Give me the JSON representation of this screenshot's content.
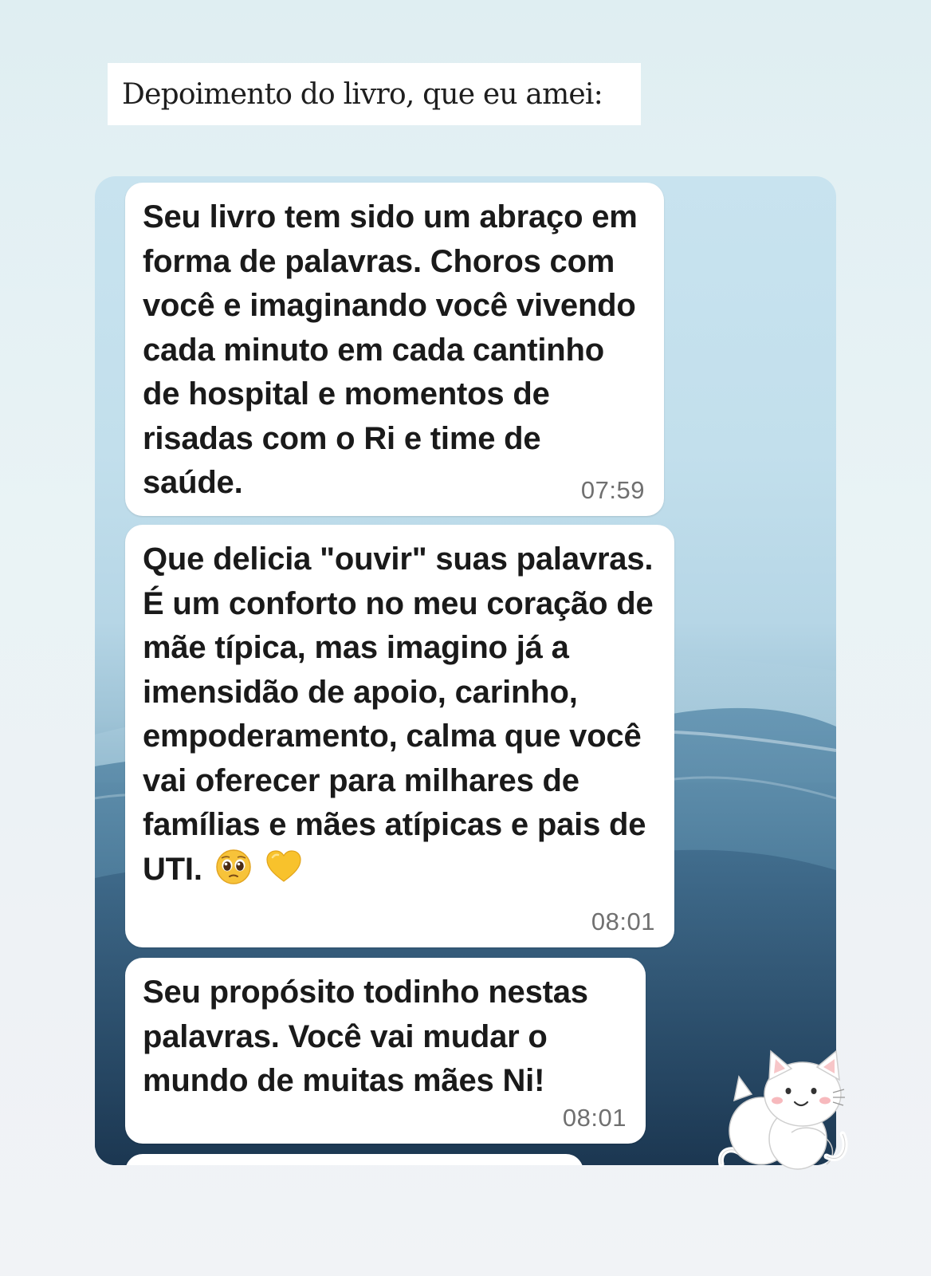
{
  "caption": {
    "text": "Depoimento do livro, que eu amei:"
  },
  "chat": {
    "messages": [
      {
        "text": "Seu livro tem sido um abraço em forma de palavras. Choros com você e imaginando você vivendo cada minuto em cada cantinho de hospital e momentos de risadas com o Ri e time de saúde.",
        "time": "07:59"
      },
      {
        "text": "Que delicia \"ouvir\" suas palavras. É um conforto no meu coração de mãe típica, mas imagino já a imensidão de apoio, carinho, empoderamento, calma que você vai oferecer para milhares de famílias e mães atípicas e pais de UTI.",
        "time": "08:01",
        "emojis": [
          "pleading-face-emoji",
          "yellow-heart-emoji"
        ]
      },
      {
        "text": "Seu propósito todinho nestas palavras. Você vai mudar o mundo de muitas mães Ni!",
        "time": "08:01"
      }
    ]
  },
  "sticker": {
    "icon": "cat-hug-sticker"
  },
  "colors": {
    "bubble": "#ffffff",
    "text": "#1a1a1a",
    "timestamp": "#707070",
    "wallpaper_top": "#c8e3ef",
    "wallpaper_bottom": "#17304a"
  }
}
